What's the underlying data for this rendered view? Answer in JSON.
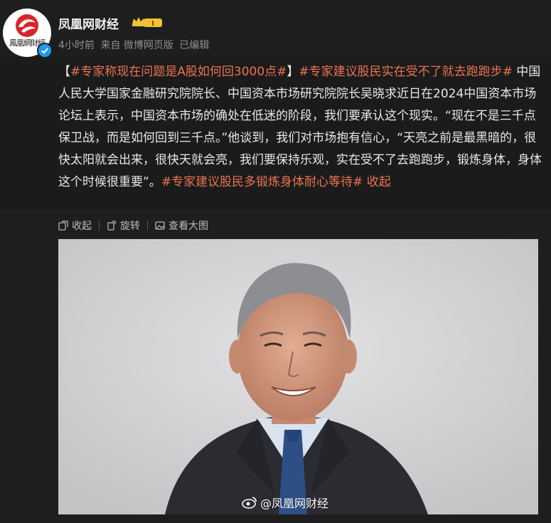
{
  "author": {
    "name": "凤凰网财经",
    "avatar_text": "鳳凰網財經",
    "vip_level": "I"
  },
  "meta": {
    "time": "4小时前",
    "source": "来自 微博网页版",
    "edited": "已编辑"
  },
  "post": {
    "bracket_open": "【",
    "tag1": "#专家称现在问题是A股如何回3000点#",
    "bracket_close": "】",
    "tag2": "#专家建议股民实在受不了就去跑跑步#",
    "body": " 中国人民大学国家金融研究院院长、中国资本市场研究院院长吴晓求近日在2024中国资本市场论坛上表示，中国资本市场的确处在低迷的阶段，我们要承认这个现实。“现在不是三千点保卫战，而是如何回到三千点。”他谈到，我们对市场抱有信心，“天亮之前是最黑暗的，很快太阳就会出来，很快天就会亮，我们要保持乐观，实在受不了去跑跑步，锻炼身体，身体这个时候很重要”。",
    "tag3": "#专家建议股民多锻炼身体耐心等待#",
    "collapse": " 收起"
  },
  "toolbar": {
    "collapse_label": "收起",
    "rotate_label": "旋转",
    "view_large_label": "查看大图"
  },
  "image": {
    "watermark": "@凤凰网财经"
  },
  "colors": {
    "accent": "#eb7350",
    "background": "#1e1e1e",
    "verified": "#1e9bf0",
    "vip": "#f2c230"
  },
  "icons": [
    "phoenix-logo-icon",
    "verified-icon",
    "vip-crown-icon",
    "collapse-icon",
    "rotate-icon",
    "view-large-icon",
    "weibo-icon"
  ]
}
